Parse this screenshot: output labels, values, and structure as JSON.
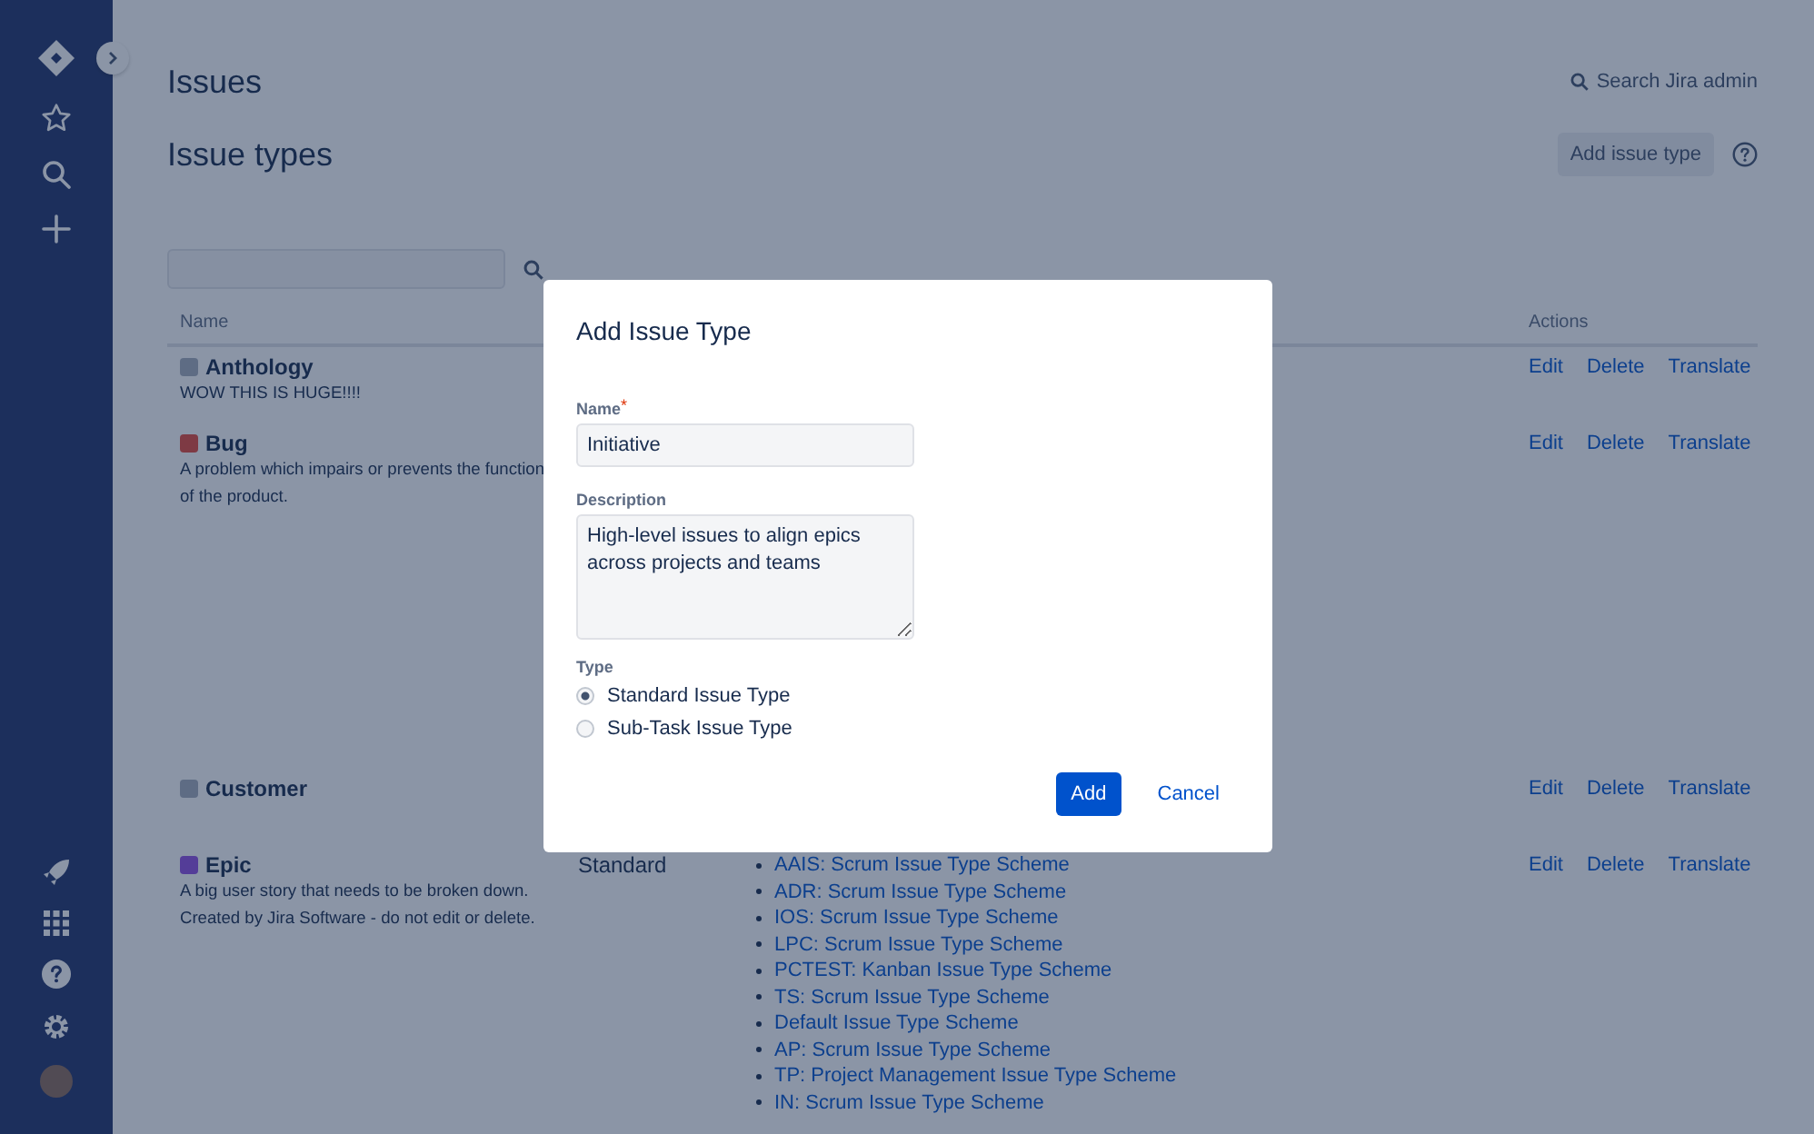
{
  "header": {
    "title": "Issues",
    "search_link": "Search Jira admin",
    "subtitle": "Issue types",
    "add_button": "Add issue type"
  },
  "table": {
    "columns": [
      "Name",
      "Actions"
    ],
    "rows": [
      {
        "name": "Anthology",
        "color": "#5e6c84",
        "description": [
          "WOW THIS IS HUGE!!!!"
        ],
        "actions": [
          "Edit",
          "Delete",
          "Translate"
        ]
      },
      {
        "name": "Bug",
        "color": "#7e3a44",
        "description": [
          "A problem which impairs or prevents the function",
          "of the product."
        ],
        "actions": [
          "Edit",
          "Delete",
          "Translate"
        ]
      },
      {
        "name": "Customer",
        "color": "#5e6c84",
        "description": [],
        "actions": [
          "Edit",
          "Delete",
          "Translate"
        ]
      },
      {
        "name": "Epic",
        "color": "#543d98",
        "description": [
          "A big user story that needs to be broken down.",
          "Created by Jira Software - do not edit or delete."
        ],
        "type": "Standard",
        "schemes": [
          "AAIS: Scrum Issue Type Scheme",
          "ADR: Scrum Issue Type Scheme",
          "IOS: Scrum Issue Type Scheme",
          "LPC: Scrum Issue Type Scheme",
          "PCTEST: Kanban Issue Type Scheme",
          "TS: Scrum Issue Type Scheme",
          "Default Issue Type Scheme",
          "AP: Scrum Issue Type Scheme",
          "TP: Project Management Issue Type Scheme",
          "IN: Scrum Issue Type Scheme"
        ],
        "actions": [
          "Edit",
          "Delete",
          "Translate"
        ]
      }
    ]
  },
  "dialog": {
    "title": "Add Issue Type",
    "name_field": {
      "label": "Name",
      "required_mark": "*",
      "value": "Initiative"
    },
    "description_field": {
      "label": "Description",
      "value": "High-level issues to align epics\nacross projects and teams"
    },
    "type_label": "Type",
    "type_options": [
      {
        "label": "Standard Issue Type",
        "selected": true
      },
      {
        "label": "Sub-Task Issue Type",
        "selected": false
      }
    ],
    "add_button": "Add",
    "cancel_link": "Cancel"
  }
}
